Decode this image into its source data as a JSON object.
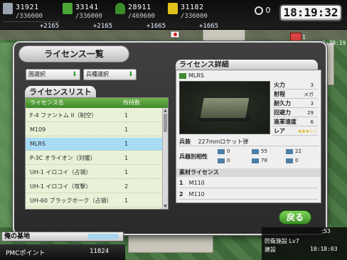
{
  "resources": [
    {
      "name": "fuel",
      "current": "31921",
      "max": "/336000",
      "income": "+2165",
      "color": "#9aa2b0"
    },
    {
      "name": "ammo",
      "current": "33141",
      "max": "/336000",
      "income": "+2165",
      "color": "#4aa536"
    },
    {
      "name": "steel",
      "current": "28911",
      "max": "/469600",
      "income": "+1665",
      "color": "#3b8c2b"
    },
    {
      "name": "bauxite",
      "current": "31182",
      "max": "/336000",
      "income": "+1665",
      "color": "#e2c21a"
    }
  ],
  "tickets": "0",
  "clock": "18:19:32",
  "gift_count": "1",
  "side_timer": "00:30:19",
  "window": {
    "title": "ライセンス一覧"
  },
  "filters": {
    "country": "国選択",
    "branch": "兵種選択"
  },
  "license_list": {
    "title": "ライセンスリスト",
    "col_name": "ライセンス名",
    "col_count": "所持数",
    "rows": [
      {
        "name": "F-4 ファントム II（制空）",
        "count": "1"
      },
      {
        "name": "M109",
        "count": "1"
      },
      {
        "name": "MLRS",
        "count": "1"
      },
      {
        "name": "P-3C オライオン（対艦）",
        "count": "1"
      },
      {
        "name": "UH-1 イロコイ（占領）",
        "count": "1"
      },
      {
        "name": "UH-1 イロコイ（攻撃）",
        "count": "2"
      },
      {
        "name": "UH-60 ブラックホーク（占領）",
        "count": "1"
      }
    ],
    "selected_index": 2
  },
  "detail": {
    "title": "ライセンス詳細",
    "unit_name": "MLRS",
    "stats": [
      {
        "label": "火力",
        "value": "3"
      },
      {
        "label": "射程",
        "value": "メガ"
      },
      {
        "label": "耐久力",
        "value": "3"
      },
      {
        "label": "回避力",
        "value": "29"
      },
      {
        "label": "進軍速度",
        "value": "6"
      },
      {
        "label": "レア",
        "value": ""
      }
    ],
    "rarity_stars": "★★★☆☆",
    "weapon_label": "兵装",
    "weapon_value": "227mmロケット弾",
    "compat_label": "兵器別相性",
    "compat": [
      {
        "icon": "aircraft-icon",
        "value": "0"
      },
      {
        "icon": "tank-icon",
        "value": "55"
      },
      {
        "icon": "ship-icon",
        "value": "22"
      },
      {
        "icon": "helicopter-icon",
        "value": "0"
      },
      {
        "icon": "armor-icon",
        "value": "78"
      },
      {
        "icon": "submarine-icon",
        "value": "0"
      }
    ],
    "materials_label": "素材ライセンス",
    "materials": [
      {
        "n": "1",
        "name": "M110"
      },
      {
        "n": "2",
        "name": "M110"
      }
    ]
  },
  "back_label": "戻る",
  "base_label": "俺の基地",
  "pmc_label": "PMCポイント",
  "pmc_value": "11824",
  "bottom_right": {
    "top": ":53",
    "name": "防衛施設 Lv7",
    "status": "建設",
    "time": "10:18:03"
  }
}
